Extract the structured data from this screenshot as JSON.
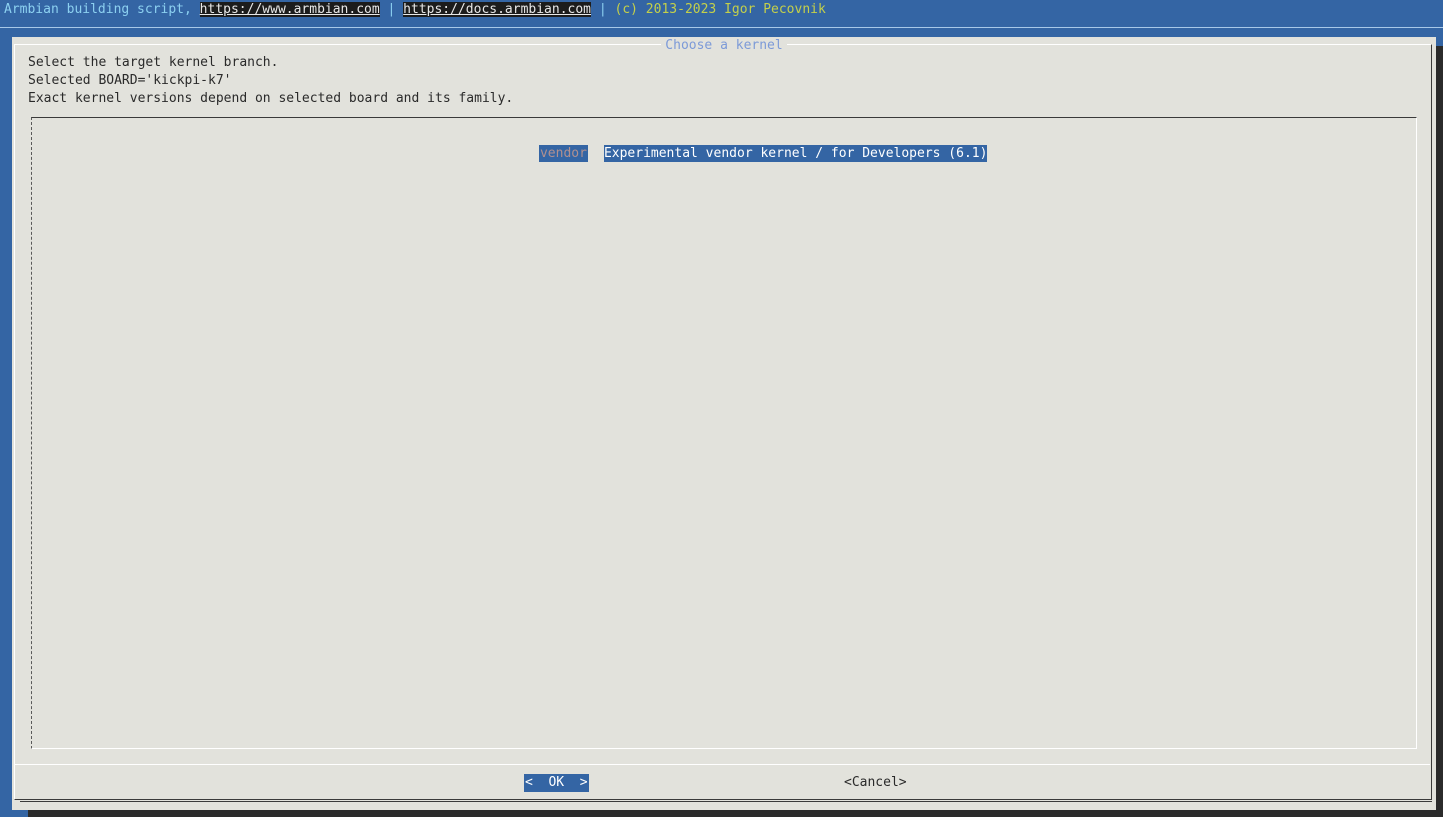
{
  "backtitle": {
    "prefix": "Armbian building script, ",
    "link1": "https://www.armbian.com",
    "sep1": " | ",
    "link2": "https://docs.armbian.com",
    "sep2": " | ",
    "copyright": "(c) 2013-2023 Igor Pecovnik"
  },
  "dialog": {
    "title": "Choose a kernel",
    "prompt_lines": [
      "Select the target kernel branch.",
      "Selected BOARD='kickpi-k7'",
      "Exact kernel versions depend on selected board and its family."
    ],
    "menu": {
      "items": [
        {
          "tag": "vendor",
          "description": "Experimental vendor kernel / for Developers (6.1)",
          "selected": true
        }
      ]
    },
    "buttons": {
      "ok": "<  OK  >",
      "cancel": "<Cancel>"
    }
  },
  "colors": {
    "screen_background": "#3465a4",
    "dialog_background": "#e2e2dc",
    "selection": "#3465a4",
    "hotkey": "#e8a000",
    "title": "#7c9ad8"
  }
}
